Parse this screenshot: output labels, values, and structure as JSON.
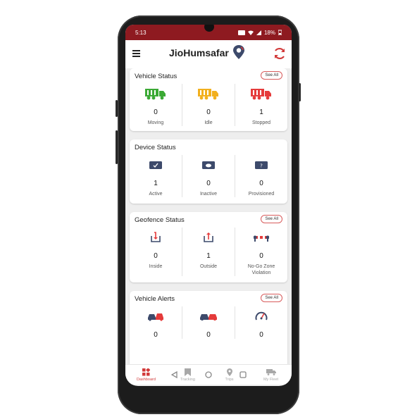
{
  "status_bar": {
    "time": "5:13",
    "battery": "18%"
  },
  "app_bar": {
    "title": "JioHumsafar"
  },
  "vehicle_status": {
    "title": "Vehicle Status",
    "see_all": "See All",
    "items": [
      {
        "count": "0",
        "label": "Moving",
        "color": "#3ba935"
      },
      {
        "count": "0",
        "label": "Idle",
        "color": "#f2b01e"
      },
      {
        "count": "1",
        "label": "Stopped",
        "color": "#e53b3b"
      }
    ]
  },
  "device_status": {
    "title": "Device Status",
    "items": [
      {
        "count": "1",
        "label": "Active"
      },
      {
        "count": "0",
        "label": "Inactive"
      },
      {
        "count": "0",
        "label": "Provisioned"
      }
    ]
  },
  "geofence_status": {
    "title": "Geofence Status",
    "see_all": "See All",
    "items": [
      {
        "count": "0",
        "label": "Inside"
      },
      {
        "count": "1",
        "label": "Outside"
      },
      {
        "count": "0",
        "label": "No-Go Zone Violation"
      }
    ]
  },
  "vehicle_alerts": {
    "title": "Vehicle Alerts",
    "see_all": "See All",
    "items": [
      {
        "count": "0"
      },
      {
        "count": "0"
      },
      {
        "count": "0"
      }
    ]
  },
  "bottom_nav": {
    "items": [
      {
        "label": "Dashboard",
        "active": true
      },
      {
        "label": "Tracking"
      },
      {
        "label": "Trips"
      },
      {
        "label": "My Fleet"
      }
    ]
  },
  "colors": {
    "brand_red": "#8e1a20",
    "accent": "#d23a3a",
    "navy": "#3d4a6b"
  }
}
